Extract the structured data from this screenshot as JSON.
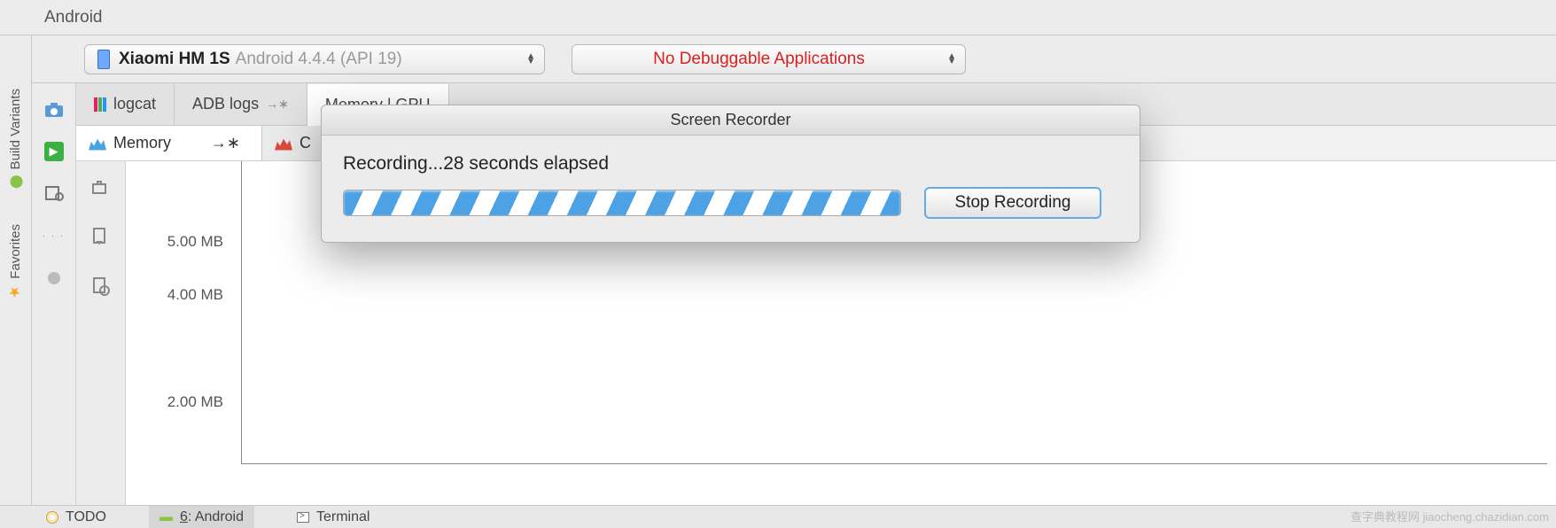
{
  "header": {
    "title": "Android"
  },
  "device_selector": {
    "name": "Xiaomi HM 1S",
    "os": "Android 4.4.4 (API 19)"
  },
  "app_selector": {
    "label": "No Debuggable Applications"
  },
  "left_rail": {
    "favorites": "Favorites",
    "build_variants": "Build Variants"
  },
  "tabs": {
    "logcat": "logcat",
    "adb_logs": "ADB logs",
    "mem_gpu": "Memory | GPU"
  },
  "subtabs": {
    "memory": "Memory",
    "cpu_partial": "C"
  },
  "chart_data": {
    "type": "line",
    "title": "",
    "xlabel": "",
    "ylabel": "",
    "y_ticks": [
      "5.00 MB",
      "4.00 MB",
      "2.00 MB"
    ],
    "ylim_mb": [
      0,
      5
    ],
    "series": []
  },
  "dialog": {
    "title": "Screen Recorder",
    "status": "Recording...28 seconds elapsed",
    "stop_label": "Stop Recording"
  },
  "bottom_bar": {
    "todo": "TODO",
    "android": "6: Android",
    "terminal": "Terminal"
  },
  "watermark": "查字典教程网 jiaocheng.chazidian.com"
}
